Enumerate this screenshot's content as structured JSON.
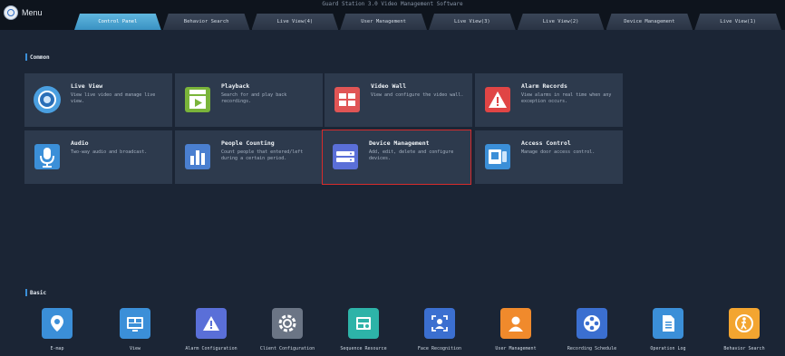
{
  "window": {
    "title": "Guard Station 3.0 Video Management Software"
  },
  "menu": {
    "label": "Menu"
  },
  "tabs": [
    "Control Panel",
    "Behavior Search",
    "Live View(4)",
    "User Management",
    "Live View(3)",
    "Live View(2)",
    "Device Management",
    "Live View(1)"
  ],
  "active_tab": "Control Panel",
  "sections": {
    "common": "Common",
    "basic": "Basic"
  },
  "cards": [
    {
      "title": "Live View",
      "desc": "View live video and manage live view.",
      "icon": "live-view-icon"
    },
    {
      "title": "Playback",
      "desc": "Search for and play back recordings.",
      "icon": "playback-icon"
    },
    {
      "title": "Video Wall",
      "desc": "View and configure the video wall.",
      "icon": "video-wall-icon"
    },
    {
      "title": "Alarm Records",
      "desc": "View alarms in real time when any exception occurs.",
      "icon": "alarm-icon"
    },
    {
      "title": "Audio",
      "desc": "Two-way audio and broadcast.",
      "icon": "microphone-icon"
    },
    {
      "title": "People Counting",
      "desc": "Count people that entered/left during a certain period.",
      "icon": "people-counting-icon"
    },
    {
      "title": "Device Management",
      "desc": "Add, edit, delete and configure devices.",
      "icon": "device-icon"
    },
    {
      "title": "Access Control",
      "desc": "Manage door access control.",
      "icon": "access-control-icon"
    }
  ],
  "selected_card": "Device Management",
  "basic_items": [
    "E-map",
    "View",
    "Alarm Configuration",
    "Client Configuration",
    "Sequence Resource",
    "Face Recognition",
    "User Management",
    "Recording Schedule",
    "Operation Log",
    "Behavior Search"
  ],
  "colors": {
    "accent": "#3a92c3",
    "selection": "#d72b2b",
    "background": "#1b2535",
    "card": "#2d3a4d"
  }
}
